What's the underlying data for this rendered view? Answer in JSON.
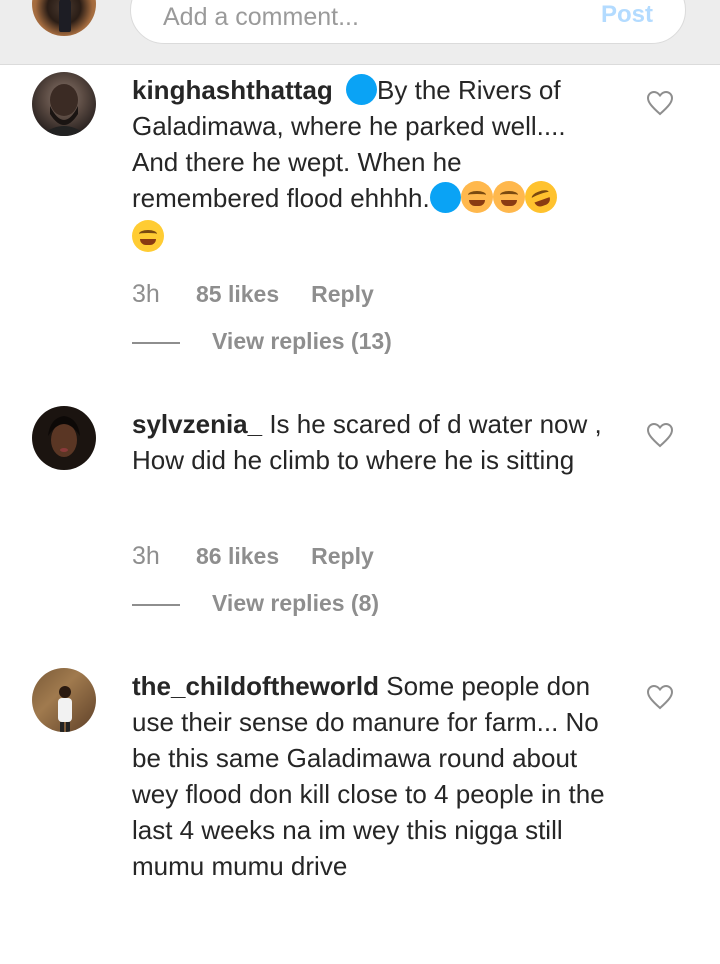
{
  "composer": {
    "placeholder": "Add a comment...",
    "post_label": "Post"
  },
  "comments": [
    {
      "username": "kinghashthattag",
      "text_parts": [
        "By the Rivers of Galadimawa, where he parked well.... And there he wept. When he remembered flood ehhhh."
      ],
      "time": "3h",
      "likes": "85 likes",
      "reply": "Reply",
      "view_replies": "View replies (13)"
    },
    {
      "username": "sylvzenia_",
      "text": "Is he scared of d water now , How did he climb to where he is sitting",
      "time": "3h",
      "likes": "86 likes",
      "reply": "Reply",
      "view_replies": "View replies (8)"
    },
    {
      "username": "the_childoftheworld",
      "text": "Some people don use their sense do manure for farm... No be this same Galadimawa round about wey flood don kill close to 4 people in the last 4 weeks na im wey this nigga still mumu mumu drive"
    }
  ],
  "icons": {
    "heart": "heart-outline-icon",
    "blue_circle": "blue-circle-emoji",
    "crying": "crying-face-emoji",
    "laughing": "laughing-face-emoji",
    "grinning": "grinning-face-emoji"
  },
  "colors": {
    "text": "#262626",
    "muted": "#8e8e8e",
    "post": "#b3dbff",
    "blue_emoji": "#0aa3f5"
  }
}
